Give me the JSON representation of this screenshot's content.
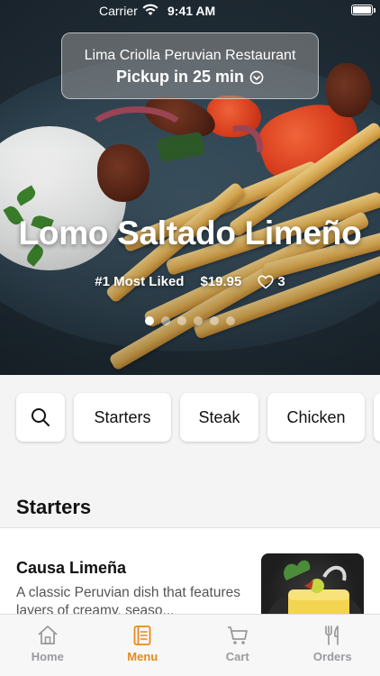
{
  "status_bar": {
    "carrier": "Carrier",
    "time": "9:41 AM"
  },
  "restaurant": {
    "name": "Lima Criolla Peruvian Restaurant",
    "pickup": "Pickup in 25 min"
  },
  "featured": {
    "title": "Lomo Saltado Limeño",
    "rank": "#1 Most Liked",
    "price": "$19.95",
    "likes": "3",
    "slides_count": 6,
    "active_slide": 1
  },
  "categories": [
    "Starters",
    "Steak",
    "Chicken"
  ],
  "section": {
    "title": "Starters",
    "items": [
      {
        "name": "Causa Limeña",
        "description": "A classic Peruvian dish that features layers of creamy, seaso..."
      }
    ]
  },
  "tabbar": {
    "tabs": [
      {
        "label": "Home",
        "icon": "home-icon"
      },
      {
        "label": "Menu",
        "icon": "menu-icon",
        "active": true
      },
      {
        "label": "Cart",
        "icon": "cart-icon"
      },
      {
        "label": "Orders",
        "icon": "fork-knife-icon"
      }
    ]
  },
  "colors": {
    "accent": "#e58a18",
    "inactive": "#9a9a9e"
  }
}
